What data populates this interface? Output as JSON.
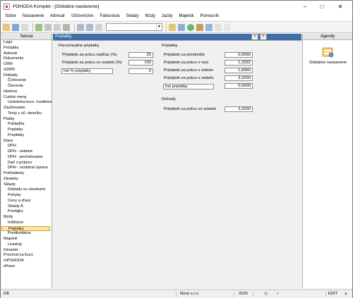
{
  "window": {
    "title": "POHODA Komplet - [Globálne nastavenie]"
  },
  "menu": [
    "Súbor",
    "Nastavenie",
    "Adresár",
    "Účtovníctvo",
    "Fakturácia",
    "Sklady",
    "Mzdy",
    "Jazdy",
    "Majetok",
    "Pomocník"
  ],
  "sidebar": {
    "header": "Sekcia",
    "items": [
      {
        "label": "Logo",
        "level": 1
      },
      {
        "label": "Pečiatka",
        "level": 1
      },
      {
        "label": "Adresár",
        "level": 1
      },
      {
        "label": "Dokumenty",
        "level": 1
      },
      {
        "label": "CRM",
        "level": 1
      },
      {
        "label": "GDPR",
        "level": 1
      },
      {
        "label": "Doklady",
        "level": 1
      },
      {
        "label": "Číslovanie",
        "level": 2
      },
      {
        "label": "Členenie",
        "level": 2
      },
      {
        "label": "História",
        "level": 1
      },
      {
        "label": "Cudzie meny",
        "level": 1
      },
      {
        "label": "Uzávierka kurz. rozdielov",
        "level": 2
      },
      {
        "label": "Zaúčtovanie",
        "level": 1
      },
      {
        "label": "Texty v úč. denníku",
        "level": 2
      },
      {
        "label": "Platby",
        "level": 1
      },
      {
        "label": "Pokladňa",
        "level": 2
      },
      {
        "label": "Poplatky",
        "level": 2
      },
      {
        "label": "Preplatky",
        "level": 2
      },
      {
        "label": "Dane",
        "level": 1
      },
      {
        "label": "DPH",
        "level": 2
      },
      {
        "label": "DPH - ostatné",
        "level": 2
      },
      {
        "label": "DPH - prečíslovanie",
        "level": 2
      },
      {
        "label": "Daň z príjmov",
        "level": 2
      },
      {
        "label": "DPH - osobitná úprava",
        "level": 2
      },
      {
        "label": "Pohľadávky",
        "level": 1
      },
      {
        "label": "Záväzky",
        "level": 1
      },
      {
        "label": "Sklady",
        "level": 1
      },
      {
        "label": "Doklady so zásobami",
        "level": 2
      },
      {
        "label": "Pohyby",
        "level": 2
      },
      {
        "label": "Ceny a zľavy",
        "level": 2
      },
      {
        "label": "Sklady A",
        "level": 2
      },
      {
        "label": "Predajky",
        "level": 2
      },
      {
        "label": "Mzdy",
        "level": 1
      },
      {
        "label": "Inštitúcie",
        "level": 2
      },
      {
        "label": "Príplatky",
        "level": 2,
        "active": true
      },
      {
        "label": "Predkontácia",
        "level": 2
      },
      {
        "label": "Majetok",
        "level": 1
      },
      {
        "label": "Leasing",
        "level": 2
      },
      {
        "label": "Intrastat",
        "level": 1
      },
      {
        "label": "Prechod na Euro",
        "level": 1
      },
      {
        "label": "mPOHODA",
        "level": 1
      },
      {
        "label": "eKasa",
        "level": 1
      }
    ]
  },
  "main": {
    "header": "Príplatky",
    "nav_prev": "<",
    "nav_next": ">",
    "percent": {
      "title": "Percentuálne príplatky",
      "rows": [
        {
          "label": "Príplatok za prácu nadčas (%)",
          "value": "25"
        },
        {
          "label": "Príplatok za prácu vo sviatok (%)",
          "value": "100"
        }
      ],
      "other_label": "Iné % príplatky",
      "other_value": "0"
    },
    "priplatky": {
      "title": "Príplatky",
      "rows": [
        {
          "label": "Príplatok za prostredie",
          "value": "0,6666"
        },
        {
          "label": "Príplatok za prácu v noci",
          "value": "1,3332"
        },
        {
          "label": "Príplatok za prácu v sobotu",
          "value": "1,6665"
        },
        {
          "label": "Príplatok za prácu v nedeľu",
          "value": "3,3330"
        }
      ],
      "other_label": "Iné príplatky",
      "other_value": "0,0000"
    },
    "dohody": {
      "title": "Dohody",
      "label": "Príplatok za prácu vo sviatok",
      "value": "3,3330"
    }
  },
  "agendy": {
    "header": "Agendy",
    "item": "Globálne nastavenie"
  },
  "status": {
    "left": "OK",
    "company": "Nový s.r.o.",
    "year": "2020",
    "mode": "EDIT"
  }
}
